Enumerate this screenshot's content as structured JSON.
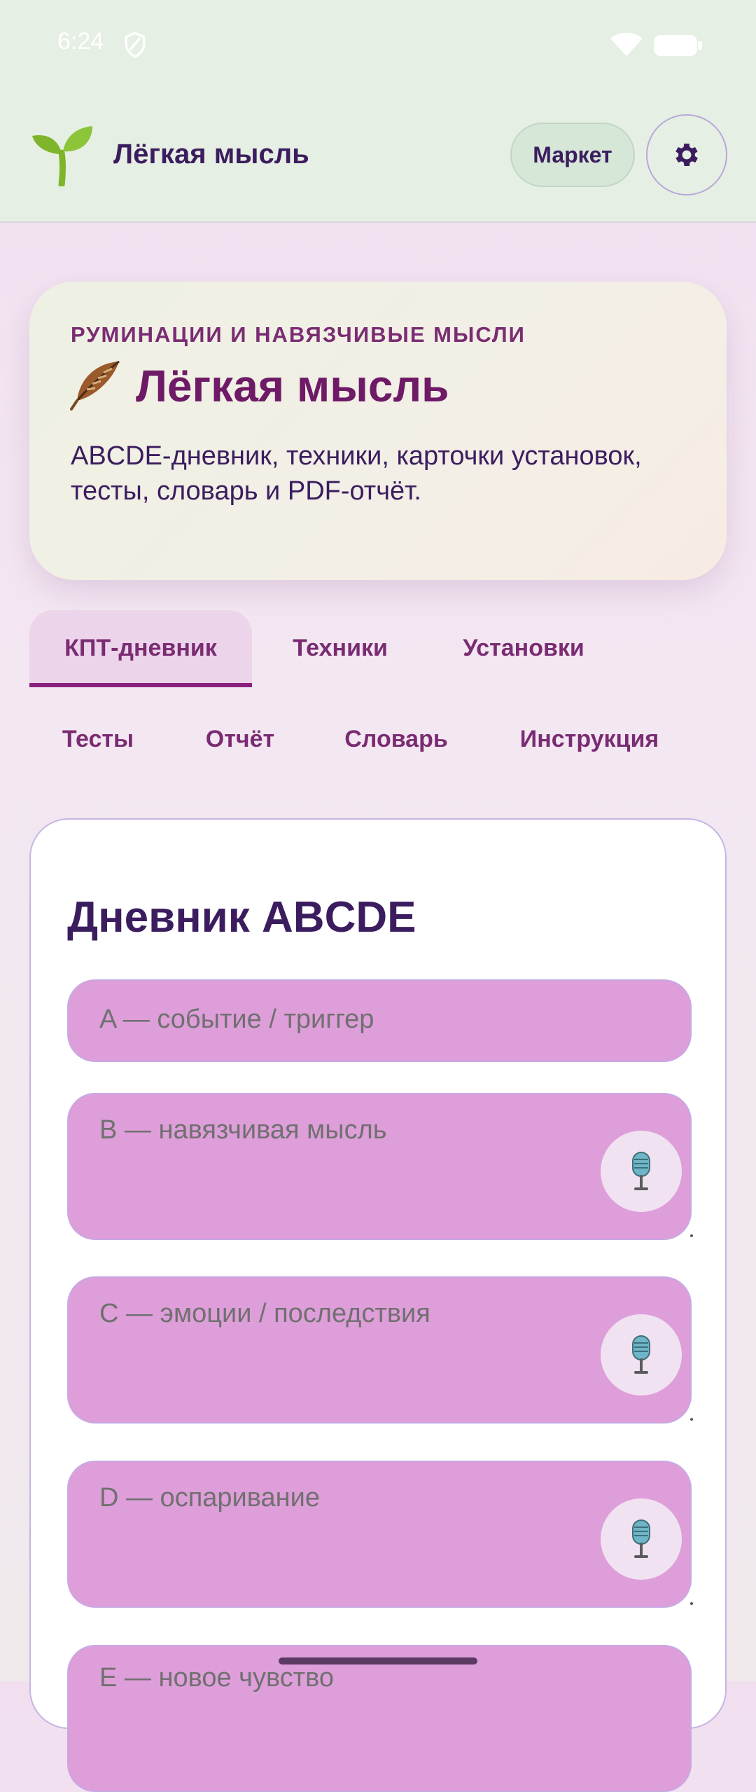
{
  "status_bar": {
    "time": "6:24"
  },
  "app_bar": {
    "title": "Лёгкая мысль",
    "market_label": "Маркет"
  },
  "hero": {
    "kicker": "РУМИНАЦИИ И НАВЯЗЧИВЫЕ МЫСЛИ",
    "title": "Лёгкая мысль",
    "description": "ABCDE-дневник, техники, карточки установок, тесты, словарь и PDF-отчёт."
  },
  "tabs": [
    {
      "label": "КПТ-дневник",
      "active": true
    },
    {
      "label": "Техники"
    },
    {
      "label": "Установки"
    },
    {
      "label": "Тесты"
    },
    {
      "label": "Отчёт"
    },
    {
      "label": "Словарь"
    },
    {
      "label": "Инструкция"
    }
  ],
  "diary": {
    "title": "Дневник ABCDE",
    "fields": [
      {
        "placeholder": "A — событие / триггер"
      },
      {
        "placeholder": "B — навязчивая мысль"
      },
      {
        "placeholder": "C — эмоции / последствия"
      },
      {
        "placeholder": "D — оспаривание"
      },
      {
        "placeholder": "E — новое чувство"
      }
    ]
  },
  "colors": {
    "accent": "#8a1f7d",
    "field_bg": "#de9ed9",
    "app_bar_bg": "#e6efe3"
  },
  "icons": [
    "shield-icon",
    "wifi-icon",
    "battery-icon",
    "sprout-logo-icon",
    "gear-icon",
    "feather-icon",
    "microphone-icon"
  ]
}
